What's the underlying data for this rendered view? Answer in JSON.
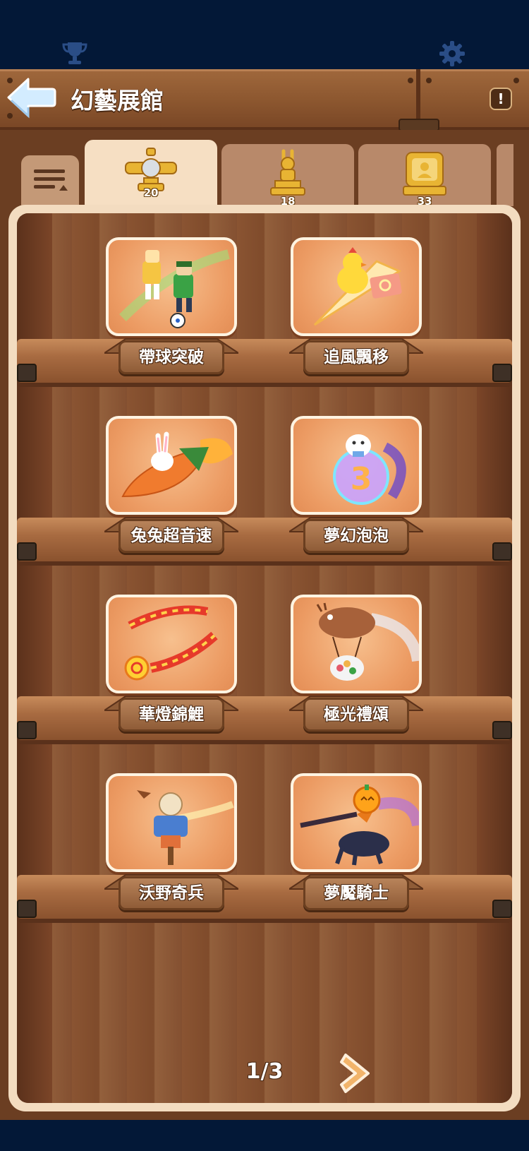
{
  "status_bar": {
    "trophy_icon": "trophy-icon",
    "settings_icon": "gear-icon",
    "icon_color": "#2a4d86"
  },
  "header": {
    "back_icon": "back-arrow-icon",
    "title": "幻藝展館",
    "info_icon": "exclamation-icon",
    "info_symbol": "!"
  },
  "tabs": [
    {
      "icon": "plane-trophy-icon",
      "count": "20",
      "active": true
    },
    {
      "icon": "rabbit-trophy-icon",
      "count": "18",
      "active": false
    },
    {
      "icon": "frame-trophy-icon",
      "count": "33",
      "active": false
    }
  ],
  "menu_tab_icon": "list-sort-icon",
  "shelf_items": [
    {
      "label": "帶球突破",
      "icon": "soccer-dribble-icon"
    },
    {
      "label": "追風飄移",
      "icon": "chick-kite-icon"
    },
    {
      "label": "兔兔超音速",
      "icon": "bunny-rocket-icon"
    },
    {
      "label": "夢幻泡泡",
      "icon": "bubble-bear-icon"
    },
    {
      "label": "華燈錦鯉",
      "icon": "koi-lantern-icon"
    },
    {
      "label": "極光禮頌",
      "icon": "airship-gift-icon"
    },
    {
      "label": "沃野奇兵",
      "icon": "scarecrow-icon"
    },
    {
      "label": "夢魘騎士",
      "icon": "pumpkin-knight-icon"
    }
  ],
  "pagination": {
    "text": "1/3",
    "next_icon": "chevron-right-icon"
  },
  "colors": {
    "gold": "#e8b433",
    "card_orange": "#ec9b63",
    "wood_dark": "#6b3e22",
    "navy": "#031837"
  }
}
